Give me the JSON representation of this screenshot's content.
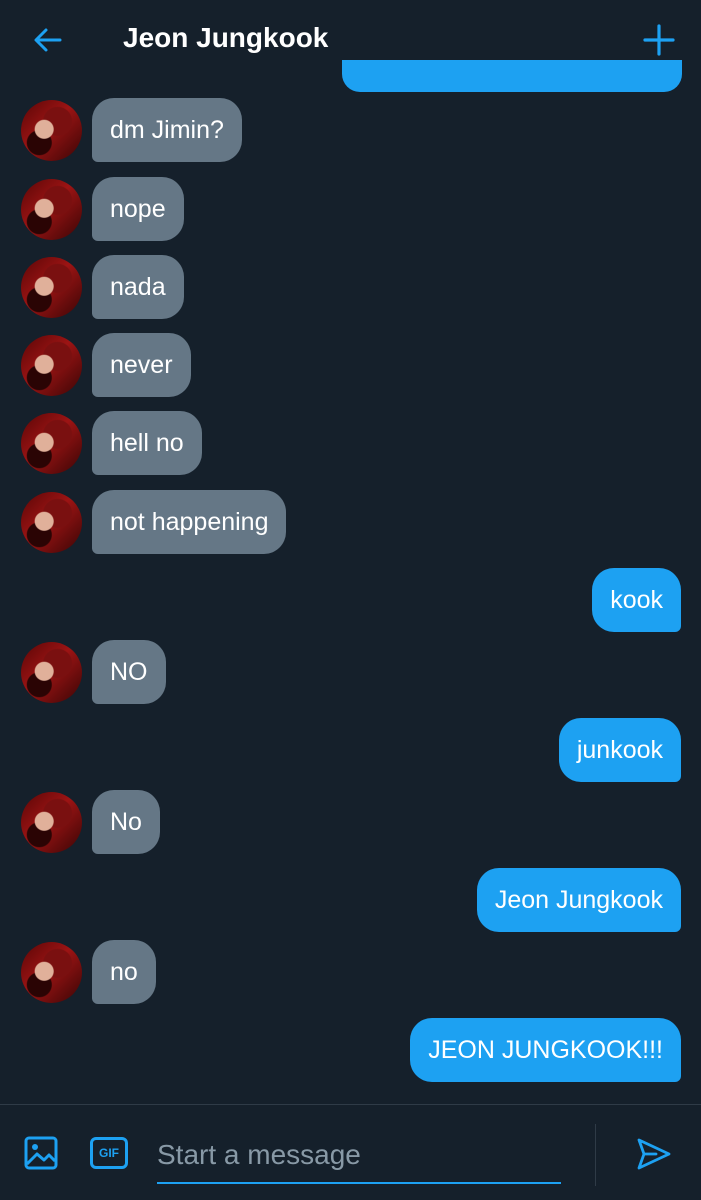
{
  "header": {
    "title": "Jeon Jungkook",
    "back_icon": "arrow-left-icon",
    "action_icon": "plus-icon"
  },
  "colors": {
    "background": "#15202b",
    "accent": "#1da1f2",
    "incoming_bubble": "#657786",
    "placeholder": "#8899a6"
  },
  "messages": [
    {
      "from": "them",
      "text": "dm Jimin?"
    },
    {
      "from": "them",
      "text": "nope"
    },
    {
      "from": "them",
      "text": "nada"
    },
    {
      "from": "them",
      "text": "never"
    },
    {
      "from": "them",
      "text": "hell no"
    },
    {
      "from": "them",
      "text": "not happening"
    },
    {
      "from": "me",
      "text": "kook"
    },
    {
      "from": "them",
      "text": "NO"
    },
    {
      "from": "me",
      "text": "junkook"
    },
    {
      "from": "them",
      "text": "No"
    },
    {
      "from": "me",
      "text": "Jeon Jungkook"
    },
    {
      "from": "them",
      "text": "no"
    },
    {
      "from": "me",
      "text": "JEON JUNGKOOK!!!"
    }
  ],
  "composer": {
    "placeholder": "Start a message",
    "gif_label": "GIF",
    "media_icon": "image-icon",
    "send_icon": "send-icon"
  }
}
